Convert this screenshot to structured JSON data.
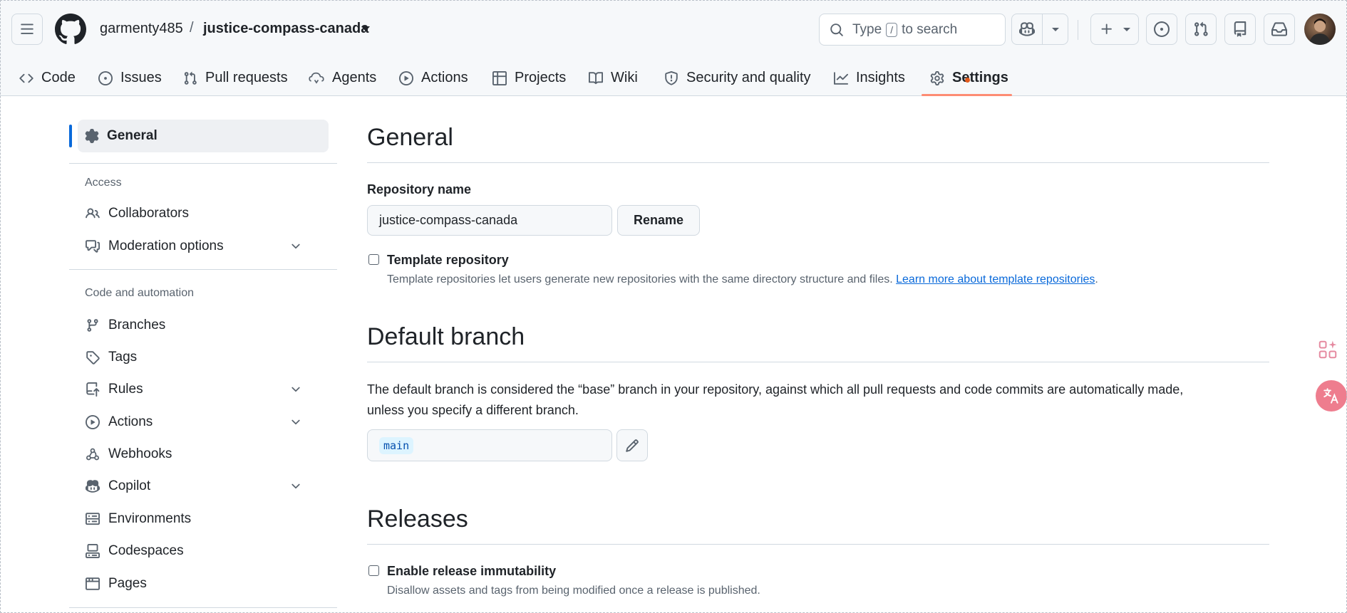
{
  "header": {
    "owner": "garmenty485",
    "separator": "/",
    "repo": "justice-compass-canada",
    "search": {
      "prefix": "Type",
      "key": "/",
      "suffix": "to search"
    }
  },
  "nav": {
    "items": [
      {
        "label": "Code",
        "icon": "code-icon"
      },
      {
        "label": "Issues",
        "icon": "issue-icon"
      },
      {
        "label": "Pull requests",
        "icon": "pull-request-icon"
      },
      {
        "label": "Agents",
        "icon": "agents-icon"
      },
      {
        "label": "Actions",
        "icon": "play-icon"
      },
      {
        "label": "Projects",
        "icon": "table-icon"
      },
      {
        "label": "Wiki",
        "icon": "book-icon"
      },
      {
        "label": "Security and quality",
        "icon": "shield-icon"
      },
      {
        "label": "Insights",
        "icon": "graph-icon"
      },
      {
        "label": "Settings",
        "icon": "gear-icon"
      }
    ],
    "active": "Settings"
  },
  "sidebar": {
    "general": "General",
    "access_heading": "Access",
    "access_items": [
      {
        "label": "Collaborators",
        "icon": "people-icon"
      },
      {
        "label": "Moderation options",
        "icon": "comment-discussion-icon",
        "expandable": true
      }
    ],
    "code_heading": "Code and automation",
    "code_items": [
      {
        "label": "Branches",
        "icon": "branch-icon"
      },
      {
        "label": "Tags",
        "icon": "tag-icon"
      },
      {
        "label": "Rules",
        "icon": "repo-push-icon",
        "expandable": true
      },
      {
        "label": "Actions",
        "icon": "play-icon",
        "expandable": true
      },
      {
        "label": "Webhooks",
        "icon": "webhook-icon"
      },
      {
        "label": "Copilot",
        "icon": "copilot-icon",
        "expandable": true
      },
      {
        "label": "Environments",
        "icon": "server-icon"
      },
      {
        "label": "Codespaces",
        "icon": "codespaces-icon"
      },
      {
        "label": "Pages",
        "icon": "browser-icon"
      }
    ]
  },
  "main": {
    "title": "General",
    "repo_name_label": "Repository name",
    "repo_name_value": "justice-compass-canada",
    "rename_button": "Rename",
    "template_title": "Template repository",
    "template_desc": "Template repositories let users generate new repositories with the same directory structure and files.",
    "template_link": "Learn more about template repositories",
    "template_checked": false,
    "default_branch_title": "Default branch",
    "default_branch_desc_1": "The default branch is considered the “base” branch in your repository, against which all pull requests and code commits are automatically made,",
    "default_branch_desc_2": "unless you specify a different branch.",
    "default_branch_value": "main",
    "releases_title": "Releases",
    "immutability_title": "Enable release immutability",
    "immutability_desc": "Disallow assets and tags from being modified once a release is published.",
    "immutability_checked": false
  },
  "colors": {
    "accent": "#0969da",
    "tab_underline": "#fd8c73",
    "header_bg": "#f6f8fa"
  }
}
